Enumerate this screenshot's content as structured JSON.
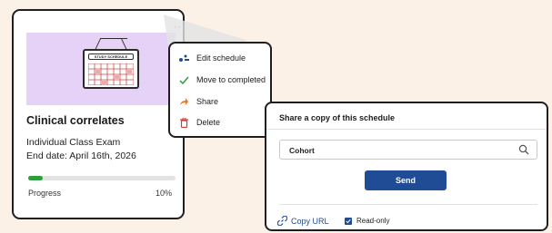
{
  "card": {
    "title": "Clinical correlates",
    "type": "Individual Class Exam",
    "end_date": "End date: April 16th, 2026",
    "thumbnail_label": "STUDY SCHEDULE",
    "progress_label": "Progress",
    "progress_value": "10%",
    "progress_fraction": 0.1,
    "more_icon": "more-horizontal-icon"
  },
  "menu": {
    "items": [
      {
        "label": "Edit schedule",
        "icon": "edit-schedule-icon",
        "color": "#1f4c95"
      },
      {
        "label": "Move to completed",
        "icon": "check-icon",
        "color": "#2c9e3a"
      },
      {
        "label": "Share",
        "icon": "share-arrow-icon",
        "color": "#e8762b"
      },
      {
        "label": "Delete",
        "icon": "trash-icon",
        "color": "#d23a3a"
      }
    ]
  },
  "share_panel": {
    "title": "Share a copy of this schedule",
    "search_value": "Cohort",
    "send_label": "Send",
    "copy_url_label": "Copy URL",
    "readonly_label": "Read-only",
    "readonly_checked": true
  },
  "colors": {
    "background": "#fbf1e6",
    "accent": "#1f4c95",
    "progress": "#2c9e3a",
    "thumbnail": "#e6d2f6"
  }
}
